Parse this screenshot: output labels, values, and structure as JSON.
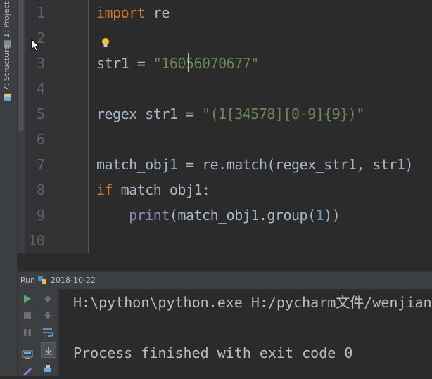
{
  "tool_strip": {
    "project_tab": "1: Project",
    "structure_tab": "7: Structure"
  },
  "editor": {
    "line_numbers": [
      "1",
      "2",
      "3",
      "4",
      "5",
      "6",
      "7",
      "8",
      "9",
      "10"
    ],
    "lines": {
      "l1_kw": "import",
      "l1_rest": " re",
      "l3_lhs": "str1 = ",
      "l3_str": "\"16056070677\"",
      "l5_lhs": "regex_str1 = ",
      "l5_str": "\"(1[34578][0-9]{9})\"",
      "l7": "match_obj1 = re.match(regex_str1, str1)",
      "l8_kw": "if",
      "l8_rest": " match_obj1:",
      "l9_indent": "    ",
      "l9_bi": "print",
      "l9_a": "(match_obj1.group(",
      "l9_num": "1",
      "l9_b": "))"
    }
  },
  "run_panel": {
    "label": "Run",
    "config_name": "2018-10-22",
    "console_lines": [
      "H:\\python\\python.exe H:/pycharm文件/wenjian",
      "",
      "Process finished with exit code 0"
    ]
  },
  "colors": {
    "keyword": "#cc7832",
    "string": "#6a8759",
    "builtin": "#8888c6",
    "number": "#6897bb",
    "text": "#a9b7c6",
    "background": "#2b2b2b"
  }
}
